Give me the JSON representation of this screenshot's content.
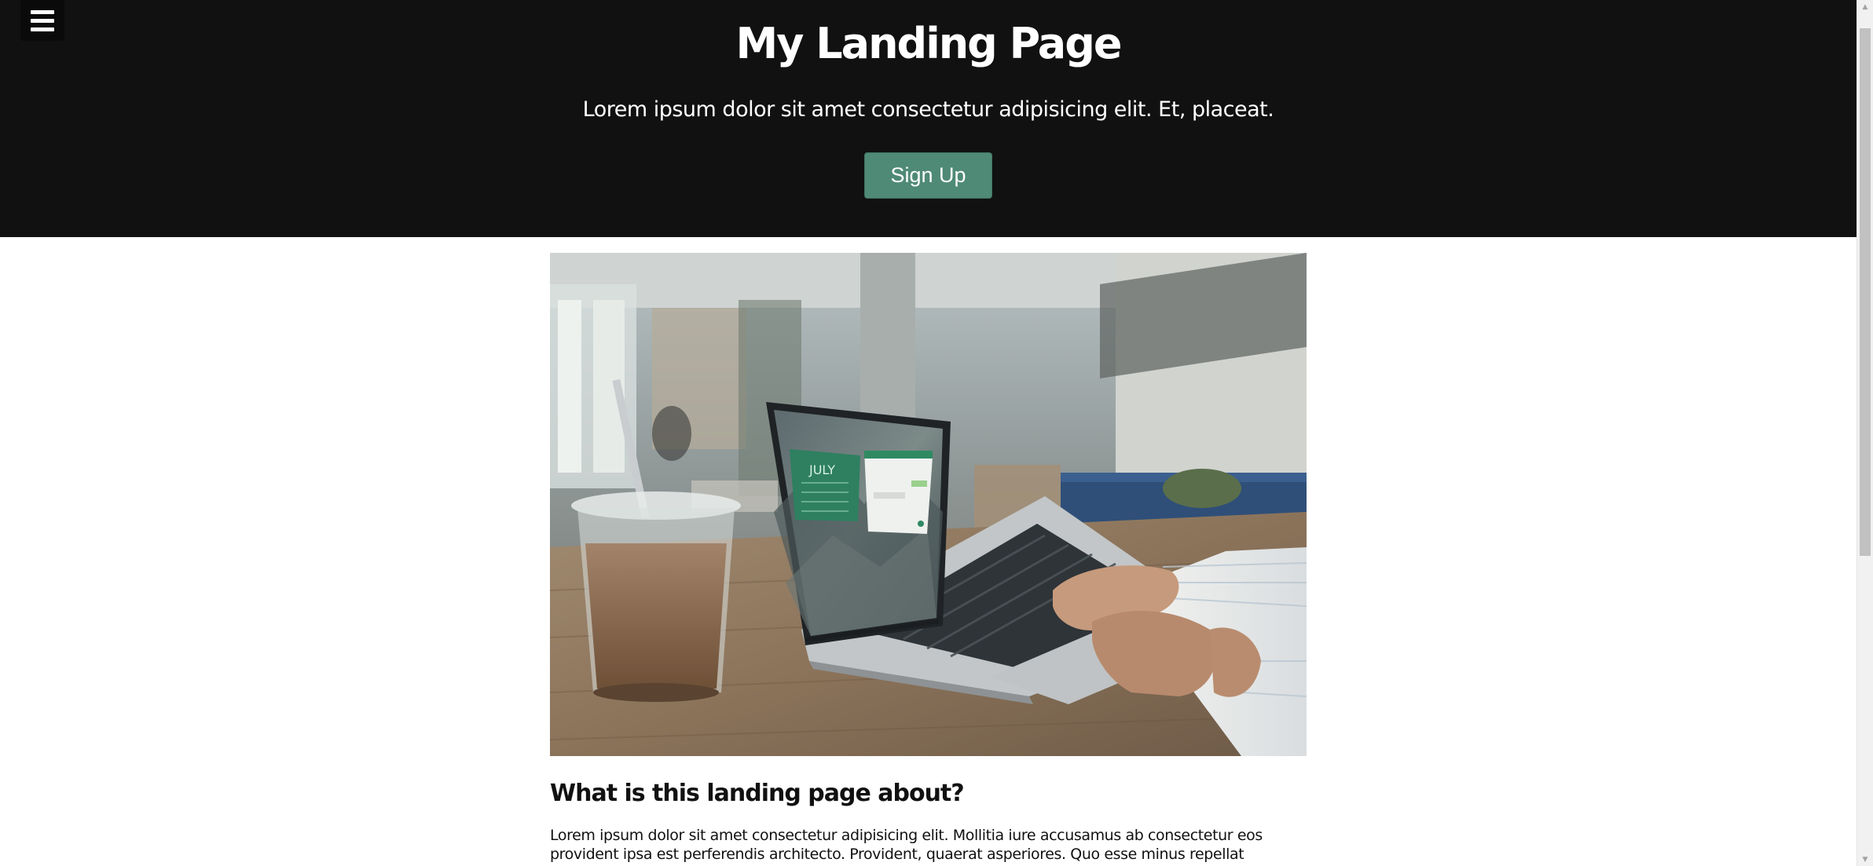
{
  "header": {
    "menu_icon": "hamburger-menu-icon",
    "title": "My Landing Page",
    "subtitle": "Lorem ipsum dolor sit amet consectetur adipisicing elit. Et, placeat.",
    "signup_label": "Sign Up",
    "background_color": "#111111",
    "button_color": "#4f8a76"
  },
  "main": {
    "image_alt": "Laptop on cafe table with iced coffee",
    "heading": "What is this landing page about?",
    "paragraph": "Lorem ipsum dolor sit amet consectetur adipisicing elit. Mollitia iure accusamus ab consectetur eos provident ipsa est perferendis architecto. Provident, quaerat asperiores. Quo esse minus repellat sapiente, impedit"
  },
  "scrollbar": {
    "up_icon": "scroll-up-arrow-icon",
    "down_icon": "scroll-down-arrow-icon"
  }
}
